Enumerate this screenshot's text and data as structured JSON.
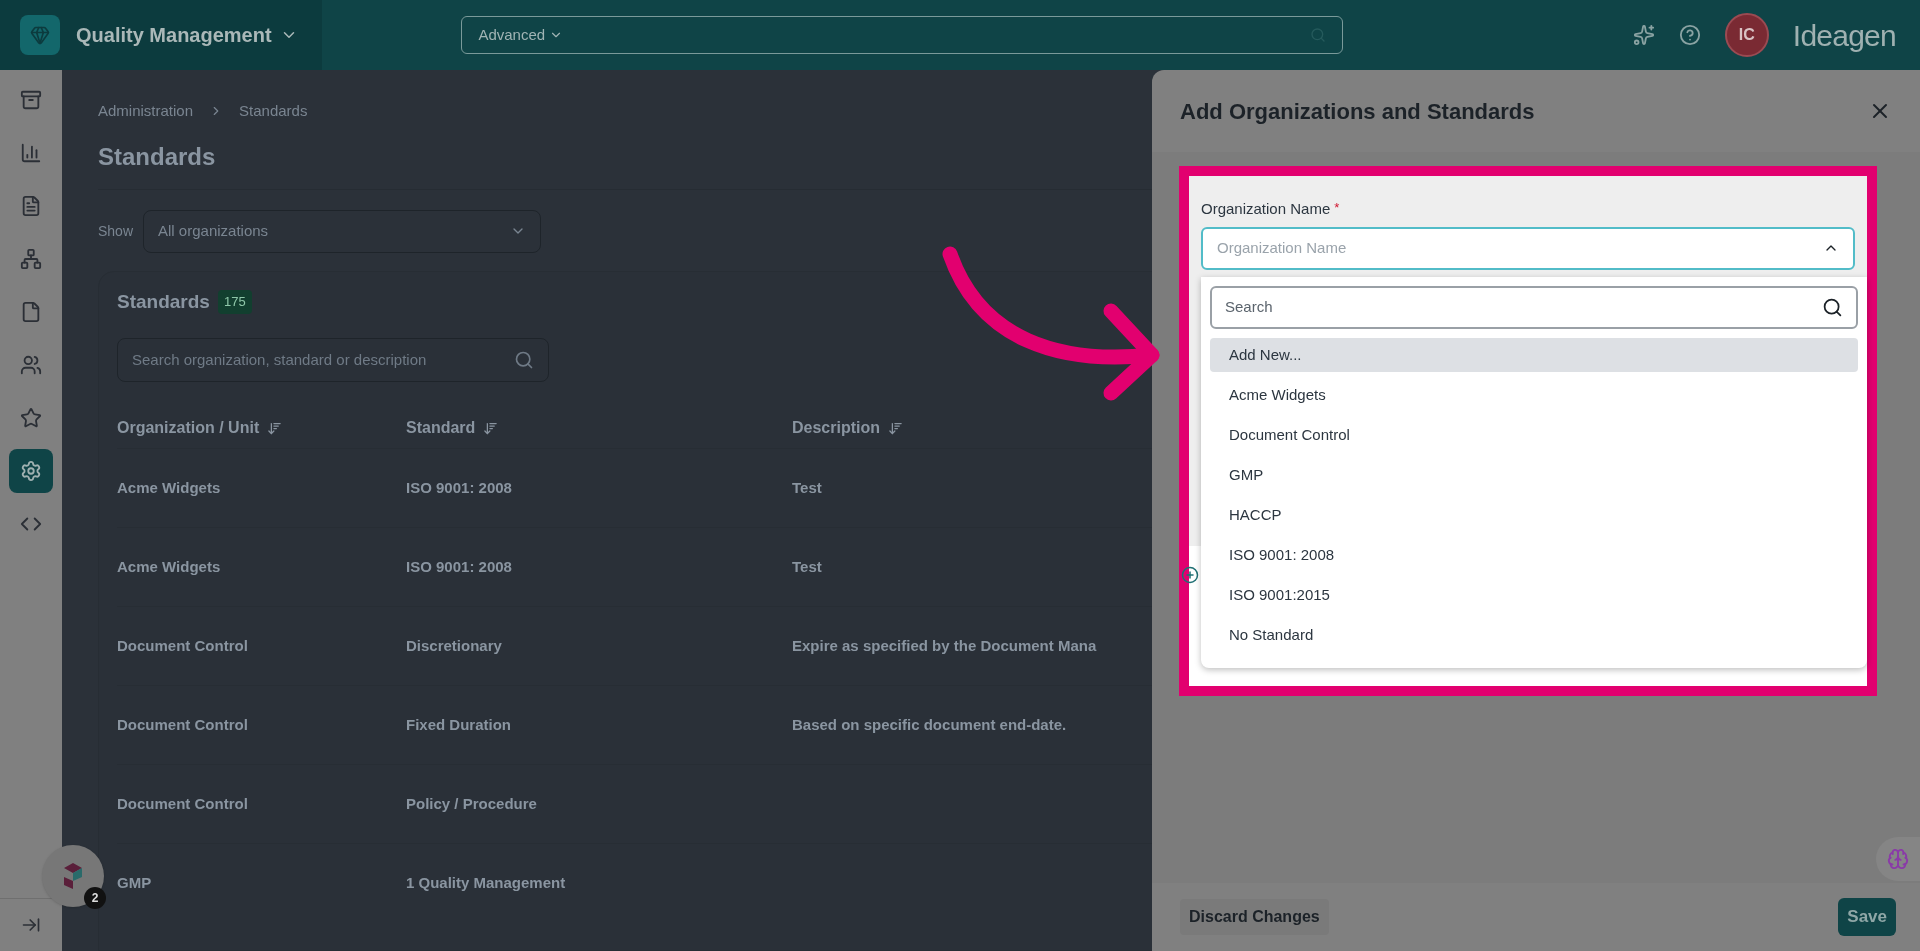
{
  "app_bar": {
    "title": "Quality Management",
    "search_scope": "Advanced",
    "avatar": "IC",
    "brand": "Ideagen"
  },
  "sidebar": {
    "items": [
      {
        "selected": false
      },
      {
        "selected": false
      },
      {
        "selected": false
      },
      {
        "selected": false
      },
      {
        "selected": false
      },
      {
        "selected": false
      },
      {
        "selected": false
      },
      {
        "selected": true
      },
      {
        "selected": false
      }
    ]
  },
  "help_widget": {
    "count": "2"
  },
  "breadcrumb": [
    "Administration",
    "Standards"
  ],
  "page_title": "Standards",
  "filter": {
    "label": "Show",
    "value": "All organizations"
  },
  "standards_card": {
    "title": "Standards",
    "count": "175",
    "search": {
      "placeholder": "Search organization, standard or description"
    },
    "columns": [
      "Organization / Unit",
      "Standard",
      "Description"
    ],
    "rows": [
      [
        "Acme Widgets",
        "ISO 9001: 2008",
        "Test"
      ],
      [
        "Acme Widgets",
        "ISO 9001: 2008",
        "Test"
      ],
      [
        "Document Control",
        "Discretionary",
        "Expire as specified by the Document Mana"
      ],
      [
        "Document Control",
        "Fixed Duration",
        "Based on specific document end-date."
      ],
      [
        "Document Control",
        "Policy / Procedure",
        ""
      ],
      [
        "GMP",
        "1 Quality Management",
        ""
      ]
    ]
  },
  "panel": {
    "title": "Add Organizations and Standards",
    "field": {
      "label": "Organization Name",
      "required_mark": "*",
      "placeholder": "Organization Name",
      "expanded": true
    },
    "dropdown": {
      "search": {
        "placeholder": "Search"
      },
      "options": [
        {
          "label": "Add New...",
          "selected": true
        },
        {
          "label": "Acme Widgets",
          "selected": false
        },
        {
          "label": "Document Control",
          "selected": false
        },
        {
          "label": "GMP",
          "selected": false
        },
        {
          "label": "HACCP",
          "selected": false
        },
        {
          "label": "ISO 9001: 2008",
          "selected": false
        },
        {
          "label": "ISO 9001:2015",
          "selected": false
        },
        {
          "label": "No Standard",
          "selected": false
        }
      ]
    },
    "discard_button": "Discard Changes",
    "save_button": "Save"
  }
}
